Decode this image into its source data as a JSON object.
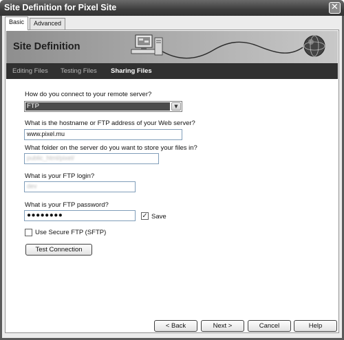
{
  "window": {
    "title": "Site Definition for Pixel Site",
    "close_glyph": "✕"
  },
  "tabs": [
    {
      "label": "Basic",
      "active": true
    },
    {
      "label": "Advanced",
      "active": false
    }
  ],
  "banner": {
    "title": "Site Definition"
  },
  "steps": [
    {
      "label": "Editing Files",
      "active": false
    },
    {
      "label": "Testing Files",
      "active": false
    },
    {
      "label": "Sharing Files",
      "active": true
    }
  ],
  "form": {
    "connect_label": "How do you connect to your remote server?",
    "connect_value": "FTP",
    "host_label": "What is the hostname or FTP address of your Web server?",
    "host_value": "www.pixel.mu",
    "folder_label": "What folder on the server do you want to store your files in?",
    "folder_value": "public_html/pixel/",
    "login_label": "What is your FTP login?",
    "login_value": "dev",
    "password_label": "What is your FTP password?",
    "password_value": "●●●●●●●●",
    "save_label": "Save",
    "save_checked": true,
    "sftp_label": "Use Secure FTP (SFTP)",
    "sftp_checked": false,
    "test_button": "Test Connection"
  },
  "footer": {
    "back": "< Back",
    "next": "Next >",
    "cancel": "Cancel",
    "help": "Help"
  },
  "icons": {
    "check": "✓",
    "dropdown": "▼"
  }
}
